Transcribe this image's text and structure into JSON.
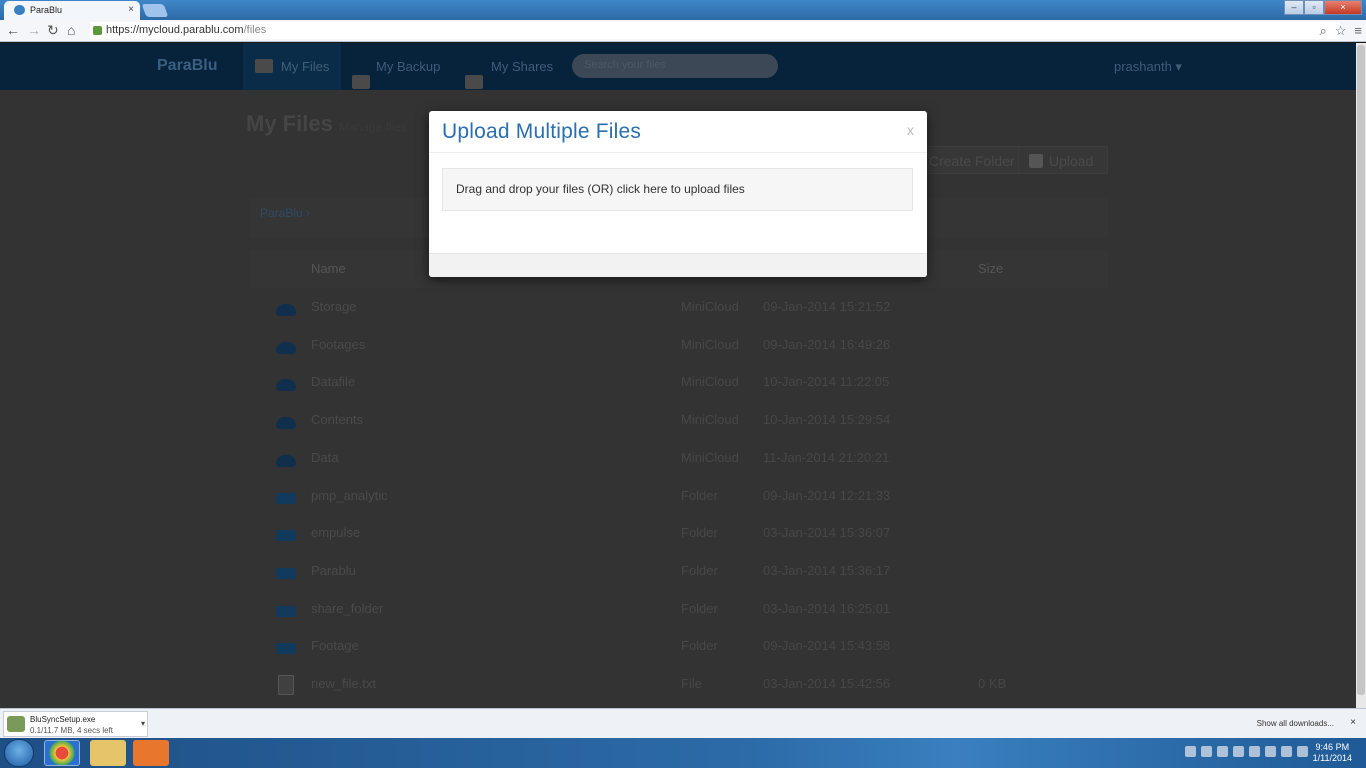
{
  "browser": {
    "tab_title": "ParaBlu",
    "tab_close": "×",
    "url_host": "https://mycloud.parablu.com",
    "url_path": "/files",
    "window_buttons": [
      "–",
      "▫",
      "×"
    ]
  },
  "app": {
    "brand": "ParaBlu",
    "nav": [
      {
        "label": "My Files"
      },
      {
        "label": "My Backup"
      },
      {
        "label": "My Shares"
      }
    ],
    "search_placeholder": "Search your files",
    "user": "prashanth ▾"
  },
  "page": {
    "title": "My Files",
    "subtitle": "Manage files",
    "create_folder": "Create Folder",
    "upload": "Upload",
    "breadcrumb": "ParaBlu ›"
  },
  "table": {
    "headers": {
      "name": "Name",
      "size": "Size"
    },
    "rows": [
      {
        "icon": "cloud",
        "name": "Storage",
        "type": "MiniCloud",
        "date": "09-Jan-2014 15:21:52",
        "size": ""
      },
      {
        "icon": "cloud",
        "name": "Footages",
        "type": "MiniCloud",
        "date": "09-Jan-2014 16:49:26",
        "size": ""
      },
      {
        "icon": "cloud",
        "name": "Datafile",
        "type": "MiniCloud",
        "date": "10-Jan-2014 11:22:05",
        "size": ""
      },
      {
        "icon": "cloud",
        "name": "Contents",
        "type": "MiniCloud",
        "date": "10-Jan-2014 15:29:54",
        "size": ""
      },
      {
        "icon": "cloud",
        "name": "Data",
        "type": "MiniCloud",
        "date": "11-Jan-2014 21:20:21",
        "size": ""
      },
      {
        "icon": "folder",
        "name": "pmp_analytic",
        "type": "Folder",
        "date": "09-Jan-2014 12:21:33",
        "size": ""
      },
      {
        "icon": "folder",
        "name": "empulse",
        "type": "Folder",
        "date": "03-Jan-2014 15:36:07",
        "size": ""
      },
      {
        "icon": "folder",
        "name": "Parablu",
        "type": "Folder",
        "date": "03-Jan-2014 15:36:17",
        "size": ""
      },
      {
        "icon": "folder",
        "name": "share_folder",
        "type": "Folder",
        "date": "03-Jan-2014 16:25:01",
        "size": ""
      },
      {
        "icon": "folder",
        "name": "Footage",
        "type": "Folder",
        "date": "09-Jan-2014 15:43:58",
        "size": ""
      },
      {
        "icon": "file",
        "name": "new_file.txt",
        "type": "File",
        "date": "03-Jan-2014 15:42:56",
        "size": "0 KB"
      }
    ]
  },
  "modal": {
    "title": "Upload Multiple Files",
    "close": "x",
    "dropzone_text": "Drag and drop your files (OR) click here to upload files"
  },
  "downloads": {
    "filename": "BluSyncSetup.exe",
    "status": "0.1/11.7 MB, 4 secs left",
    "show_all": "Show all downloads...",
    "close": "×"
  },
  "taskbar": {
    "time": "9:46 PM",
    "date": "1/11/2014"
  }
}
